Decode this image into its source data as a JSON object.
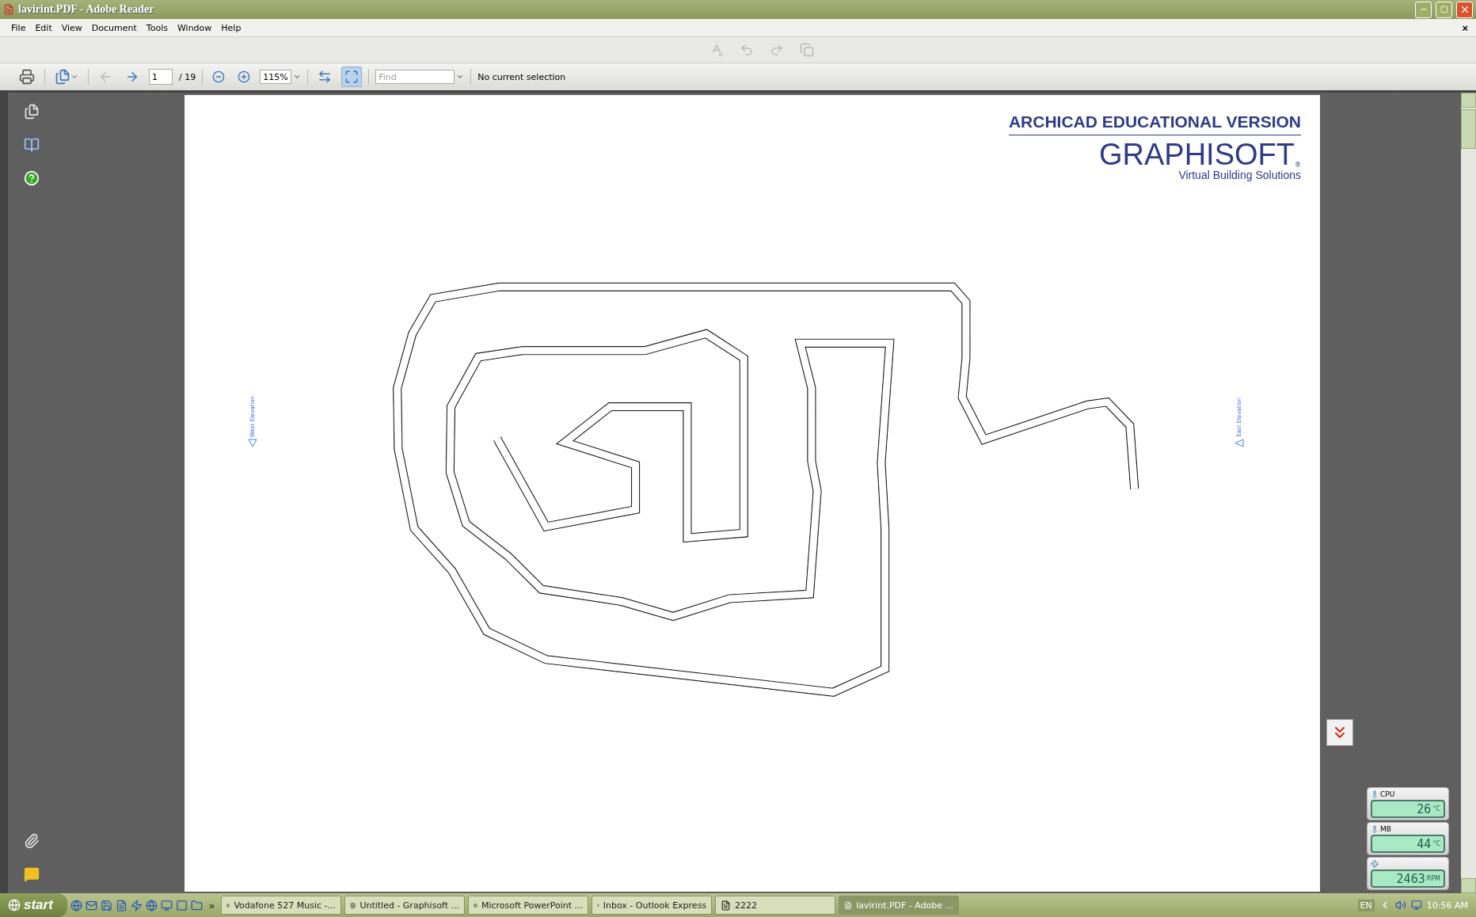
{
  "window": {
    "title": "lavirint.PDF - Adobe Reader"
  },
  "menu": {
    "items": [
      "File",
      "Edit",
      "View",
      "Document",
      "Tools",
      "Window",
      "Help"
    ],
    "close": "×"
  },
  "toolbar_top": {
    "items": [
      {
        "kind": "spellcheck",
        "disabled": true
      },
      {
        "kind": "undo",
        "disabled": true
      },
      {
        "kind": "redo",
        "disabled": true
      },
      {
        "kind": "copy",
        "disabled": true
      }
    ]
  },
  "toolbar": {
    "prev_disabled": true,
    "page_value": "1",
    "page_total": "/ 19",
    "zoom_value": "115%",
    "view_buttons": [
      {
        "kind": "fit-width",
        "selected": false
      },
      {
        "kind": "fit-page",
        "selected": true
      }
    ],
    "find_placeholder": "Find",
    "selection_status": "No current selection"
  },
  "document": {
    "heading": "ARCHICAD EDUCATIONAL VERSION",
    "brand": "GRAPHISOFT",
    "registered": "®",
    "tagline": "Virtual Building Solutions",
    "elevation_labels": [
      {
        "text": "West Elevation"
      },
      {
        "text": "East Elevation"
      }
    ]
  },
  "gadgets": [
    {
      "kind": "temperature",
      "label": "CPU",
      "reading": "26",
      "unit": "°C"
    },
    {
      "kind": "temperature",
      "label": "MB",
      "reading": "44",
      "unit": "°C"
    },
    {
      "kind": "fan",
      "reading": "2463",
      "unit": "RPM"
    }
  ],
  "taskbar": {
    "start": "start",
    "overflow": "»",
    "tasks": [
      {
        "label": "Vodafone 527 Music -...",
        "selected": false
      },
      {
        "label": "Untitled - Graphisoft ...",
        "selected": false
      },
      {
        "label": "Microsoft PowerPoint ...",
        "selected": false
      },
      {
        "label": "Inbox - Outlook Express",
        "selected": false
      },
      {
        "label": "2222",
        "selected": false
      },
      {
        "label": "lavirint.PDF - Adobe ...",
        "selected": true
      }
    ],
    "language": "EN",
    "clock": "10:56 AM"
  }
}
